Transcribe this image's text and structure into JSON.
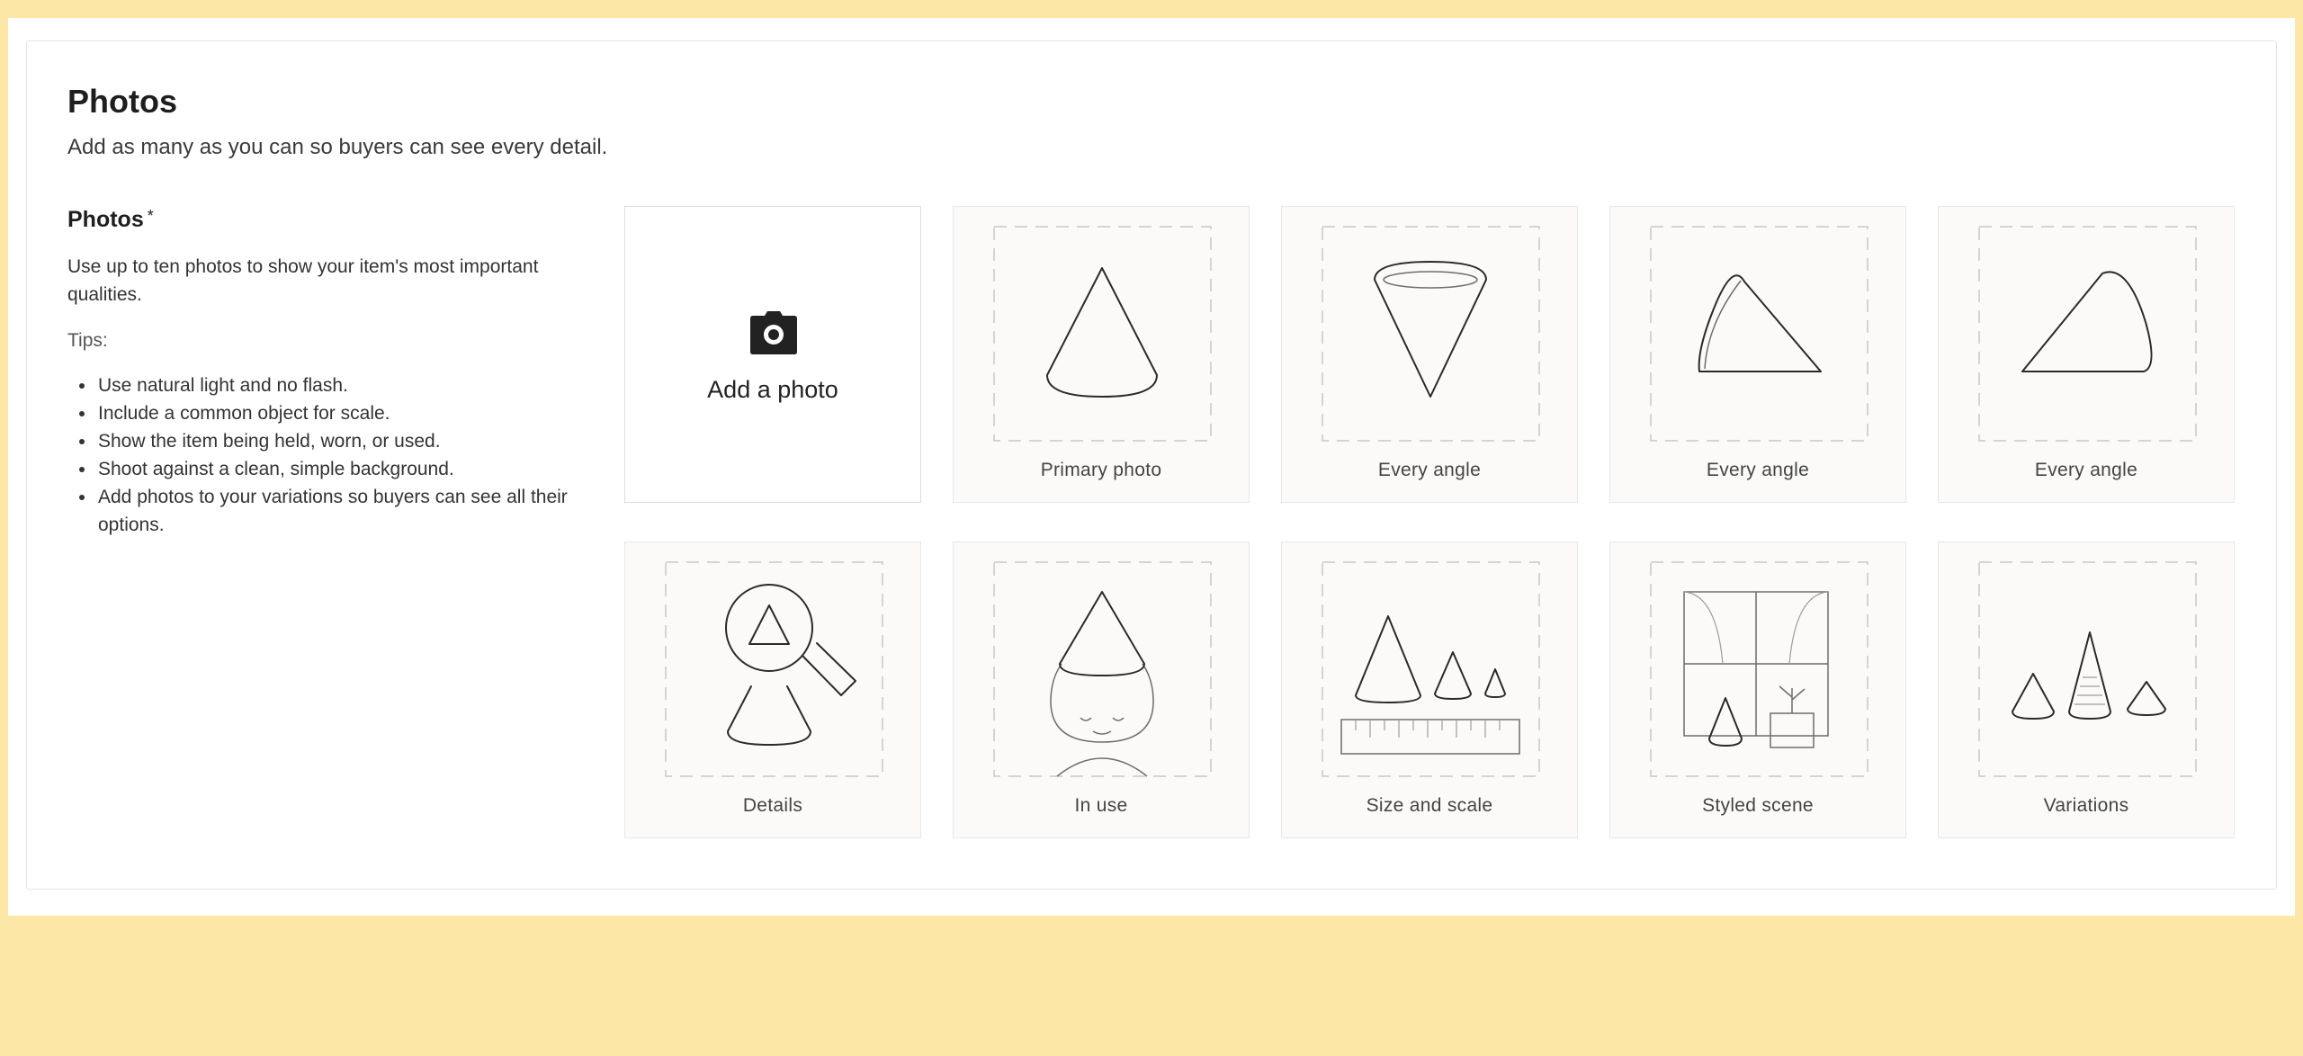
{
  "section": {
    "title": "Photos",
    "subtitle": "Add as many as you can so buyers can see every detail."
  },
  "field": {
    "label": "Photos",
    "required_marker": "*",
    "description": "Use up to ten photos to show your item's most important qualities."
  },
  "tips": {
    "heading": "Tips:",
    "items": [
      "Use natural light and no flash.",
      "Include a common object for scale.",
      "Show the item being held, worn, or used.",
      "Shoot against a clean, simple background.",
      "Add photos to your variations so buyers can see all their options."
    ]
  },
  "upload": {
    "label": "Add a photo",
    "icon": "camera-icon"
  },
  "slots": [
    {
      "label": "Primary photo",
      "illustration": "cone-upright"
    },
    {
      "label": "Every angle",
      "illustration": "cone-inverted"
    },
    {
      "label": "Every angle",
      "illustration": "cone-tilted-left"
    },
    {
      "label": "Every angle",
      "illustration": "cone-side"
    },
    {
      "label": "Details",
      "illustration": "magnifier-cone"
    },
    {
      "label": "In use",
      "illustration": "cone-hat-person"
    },
    {
      "label": "Size and scale",
      "illustration": "cones-with-ruler"
    },
    {
      "label": "Styled scene",
      "illustration": "cone-window-scene"
    },
    {
      "label": "Variations",
      "illustration": "three-cones"
    }
  ],
  "colors": {
    "page_background": "#fde7a7",
    "card_background": "#ffffff",
    "tile_background": "#fbfaf9",
    "text": "#222222"
  }
}
